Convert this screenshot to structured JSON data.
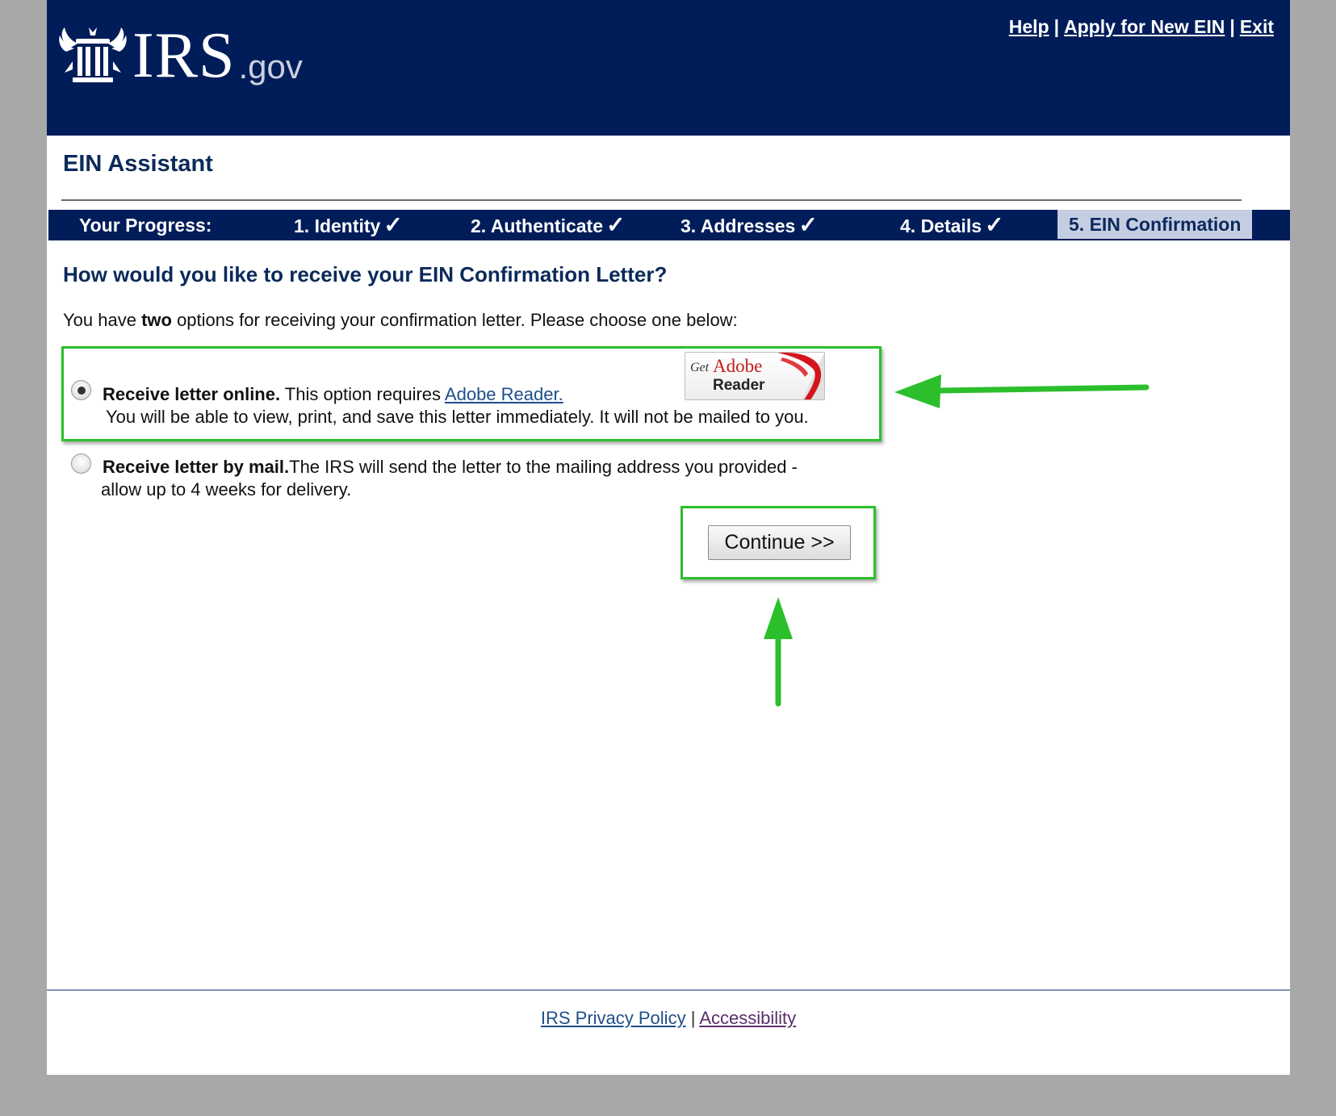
{
  "header": {
    "logo_main": "IRS",
    "logo_suffix": ".gov",
    "links": {
      "help": "Help",
      "apply": "Apply for New EIN",
      "exit": "Exit",
      "separator": "|"
    }
  },
  "app_title": "EIN Assistant",
  "progress": {
    "label": "Your Progress:",
    "steps": [
      {
        "label": "1. Identity",
        "done": true
      },
      {
        "label": "2. Authenticate",
        "done": true
      },
      {
        "label": "3. Addresses",
        "done": true
      },
      {
        "label": "4. Details",
        "done": true
      },
      {
        "label": "5. EIN Confirmation",
        "done": false,
        "current": true
      }
    ],
    "check_glyph": "✓"
  },
  "question": "How would you like to receive your EIN Confirmation Letter?",
  "intro": {
    "pre": "You have ",
    "bold": "two",
    "post": " options for receiving your confirmation letter. Please choose one below:"
  },
  "options": {
    "online": {
      "selected": true,
      "title": "Receive letter online.",
      "text": " This option requires ",
      "link": "Adobe Reader.",
      "line2": "You will be able to view, print, and save this letter immediately. It will not be mailed to you."
    },
    "mail": {
      "selected": false,
      "title": "Receive letter by mail.",
      "text": "The IRS will send the letter to the mailing address you provided -",
      "line2": "allow up to 4 weeks for delivery."
    }
  },
  "adobe_badge": {
    "get": "Get",
    "adobe": "Adobe",
    "reader": "Reader"
  },
  "continue_label": "Continue >>",
  "footer": {
    "privacy": "IRS Privacy Policy",
    "separator": "|",
    "accessibility": "Accessibility"
  },
  "colors": {
    "navy": "#001d5a",
    "highlight_green": "#2cbf2c",
    "current_step_bg": "#c5cde3"
  }
}
